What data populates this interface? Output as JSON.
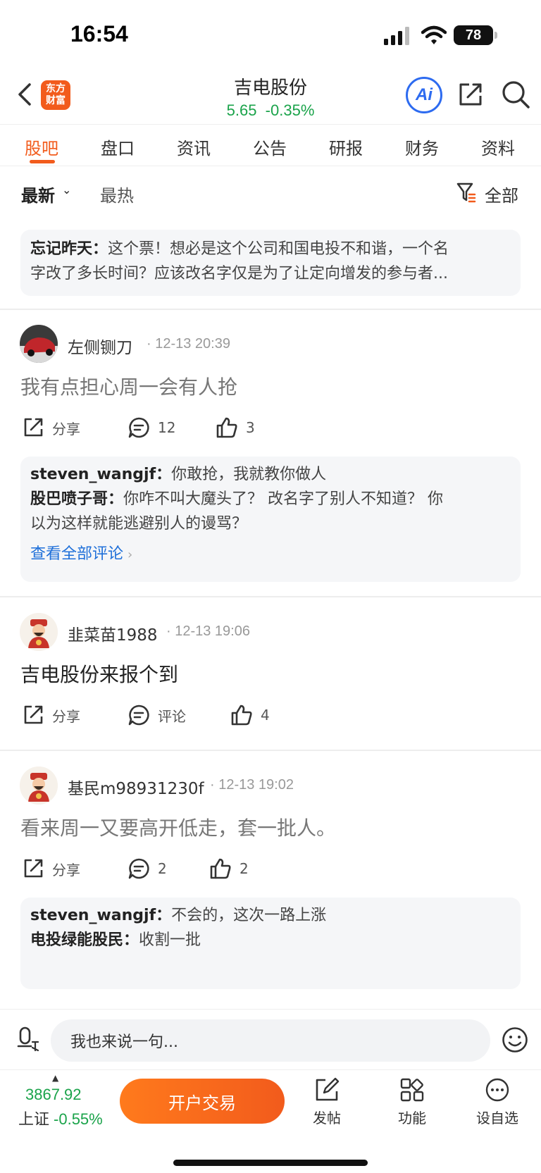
{
  "status_bar": {
    "time": "16:54",
    "battery": "78"
  },
  "header": {
    "logo_line1": "东方",
    "logo_line2": "财富",
    "title": "吉电股份",
    "quote": "5.65  -0.35%",
    "ai_label": "Ai"
  },
  "tabs": [
    {
      "label": "股吧",
      "active": true
    },
    {
      "label": "盘口"
    },
    {
      "label": "资讯"
    },
    {
      "label": "公告"
    },
    {
      "label": "研报"
    },
    {
      "label": "财务"
    },
    {
      "label": "资料"
    }
  ],
  "filter": {
    "latest": "最新",
    "hot": "最热",
    "all": "全部"
  },
  "top_comment": {
    "author": "忘记昨天：",
    "line1": "这个票！想必是这个公司和国电投不和谐，一个名",
    "line2": "字改了多长时间？应该改名字仅是为了让定向增发的参与者..."
  },
  "posts": [
    {
      "username": "左侧铡刀",
      "time": "12-13 20:39",
      "text": "我有点担心周一会有人抢",
      "share": "分享",
      "comments": "12",
      "likes": "3",
      "replies": [
        {
          "author": "steven_wangjf：",
          "text": "你敢抢，我就教你做人"
        },
        {
          "author": "股巴喷子哥：",
          "text": "你咋不叫大魔头了？ 改名字了别人不知道？ 你",
          "text2": "以为这样就能逃避别人的谩骂？"
        }
      ],
      "view_all": "查看全部评论"
    },
    {
      "username": "韭菜苗1988",
      "time": "12-13 19:06",
      "text": "吉电股份来报个到",
      "share": "分享",
      "comments": "评论",
      "likes": "4"
    },
    {
      "username": "基民m98931230f",
      "time": "12-13 19:02",
      "text": "看来周一又要高开低走，套一批人。",
      "share": "分享",
      "comments": "2",
      "likes": "2",
      "replies": [
        {
          "author": "steven_wangjf：",
          "text": "不会的，这次一路上涨"
        },
        {
          "author": "电投绿能股民：",
          "text": "收割一批"
        }
      ]
    }
  ],
  "input": {
    "placeholder": "我也来说一句..."
  },
  "bottom_bar": {
    "index_value": "3867.92",
    "index_name": "上证",
    "index_change": "-0.55%",
    "trade_button": "开户交易",
    "post": "发帖",
    "functions": "功能",
    "watchlist": "设自选"
  },
  "colors": {
    "accent": "#f25b1c",
    "down_green": "#1aa34a",
    "ai_blue": "#2d6bf0",
    "link": "#1e6fd9"
  }
}
